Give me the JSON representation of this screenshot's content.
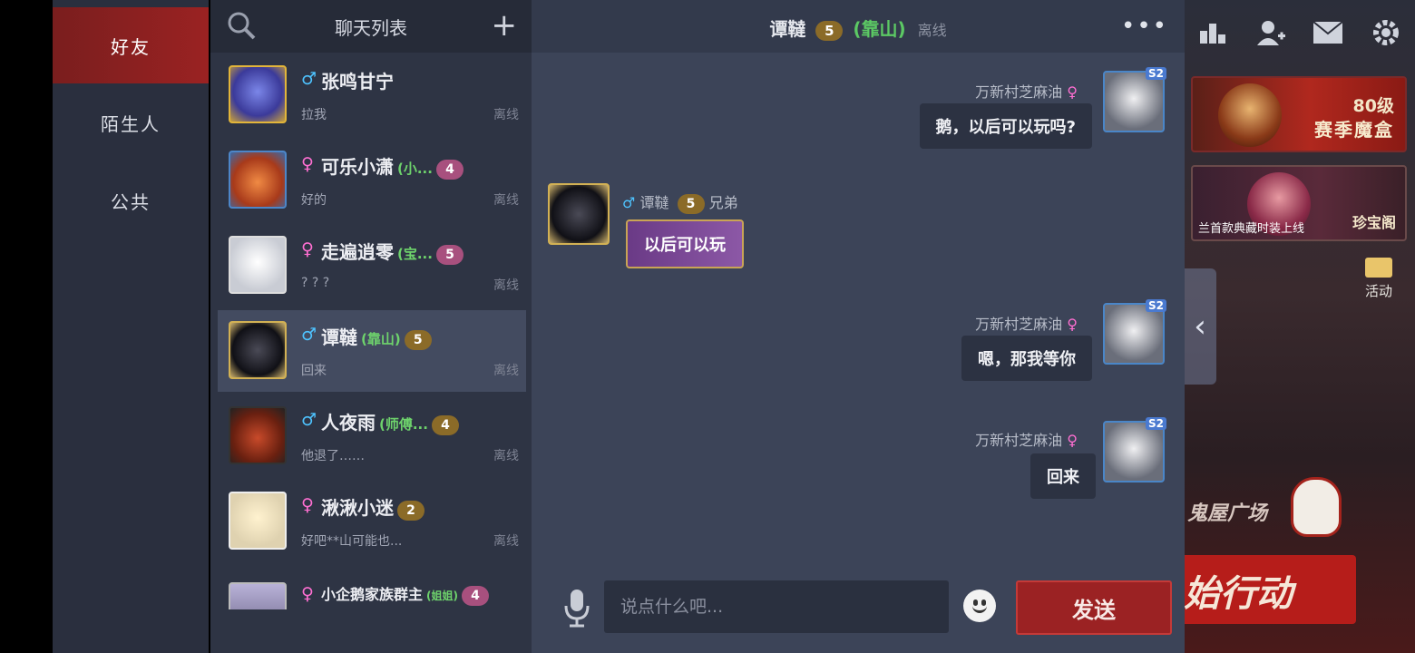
{
  "nav": {
    "items": [
      {
        "label": "好友",
        "active": true
      },
      {
        "label": "陌生人",
        "active": false
      },
      {
        "label": "公共",
        "active": false
      }
    ]
  },
  "chat_list": {
    "title": "聊天列表",
    "rows": [
      {
        "gender": "male",
        "name": "张鸣甘宁",
        "tag": "",
        "level": "",
        "message": "拉我",
        "status": "离线"
      },
      {
        "gender": "female",
        "name": "可乐小潇",
        "tag": "(小...",
        "level": "4",
        "message": "好的",
        "status": "离线"
      },
      {
        "gender": "female",
        "name": "走遍逍零",
        "tag": "(宝...",
        "level": "5",
        "message": "? ? ?",
        "status": "离线"
      },
      {
        "gender": "male",
        "name": "谭韃",
        "tag": "(靠山)",
        "level": "5",
        "message": "回来",
        "status": "离线"
      },
      {
        "gender": "male",
        "name": "人夜雨",
        "tag": "(师傅...",
        "level": "4",
        "message": "他退了……",
        "status": "离线"
      },
      {
        "gender": "female",
        "name": "湫湫小迷",
        "tag": "",
        "level": "2",
        "message": "好吧**山可能也...",
        "status": "离线"
      },
      {
        "gender": "female",
        "name": "小企鹅家族群主",
        "tag": "(姐姐)",
        "level": "4",
        "message": "",
        "status": ""
      }
    ]
  },
  "chat": {
    "header": {
      "name": "谭韃",
      "level": "5",
      "relation": "(靠山)",
      "status": "离线"
    },
    "messages": [
      {
        "side": "right",
        "sender": "万新村芝麻油",
        "text": "鹅，以后可以玩吗?"
      },
      {
        "side": "left",
        "sender": "谭韃",
        "level": "5",
        "relation": "兄弟",
        "text": "以后可以玩"
      },
      {
        "side": "right",
        "sender": "万新村芝麻油",
        "text": "嗯，那我等你"
      },
      {
        "side": "right",
        "sender": "万新村芝麻油",
        "text": "回来"
      }
    ],
    "composer": {
      "placeholder": "说点什么吧...",
      "send_label": "发送"
    }
  },
  "game": {
    "banner1_level": "80级",
    "banner1_title": "赛季魔盒",
    "banner2_sub": "兰首款典藏时装上线",
    "banner2_title": "珍宝阁",
    "activity_label": "活动",
    "plaza_label": "鬼屋广场",
    "action_label": "始行动",
    "season_badge": "S2"
  }
}
